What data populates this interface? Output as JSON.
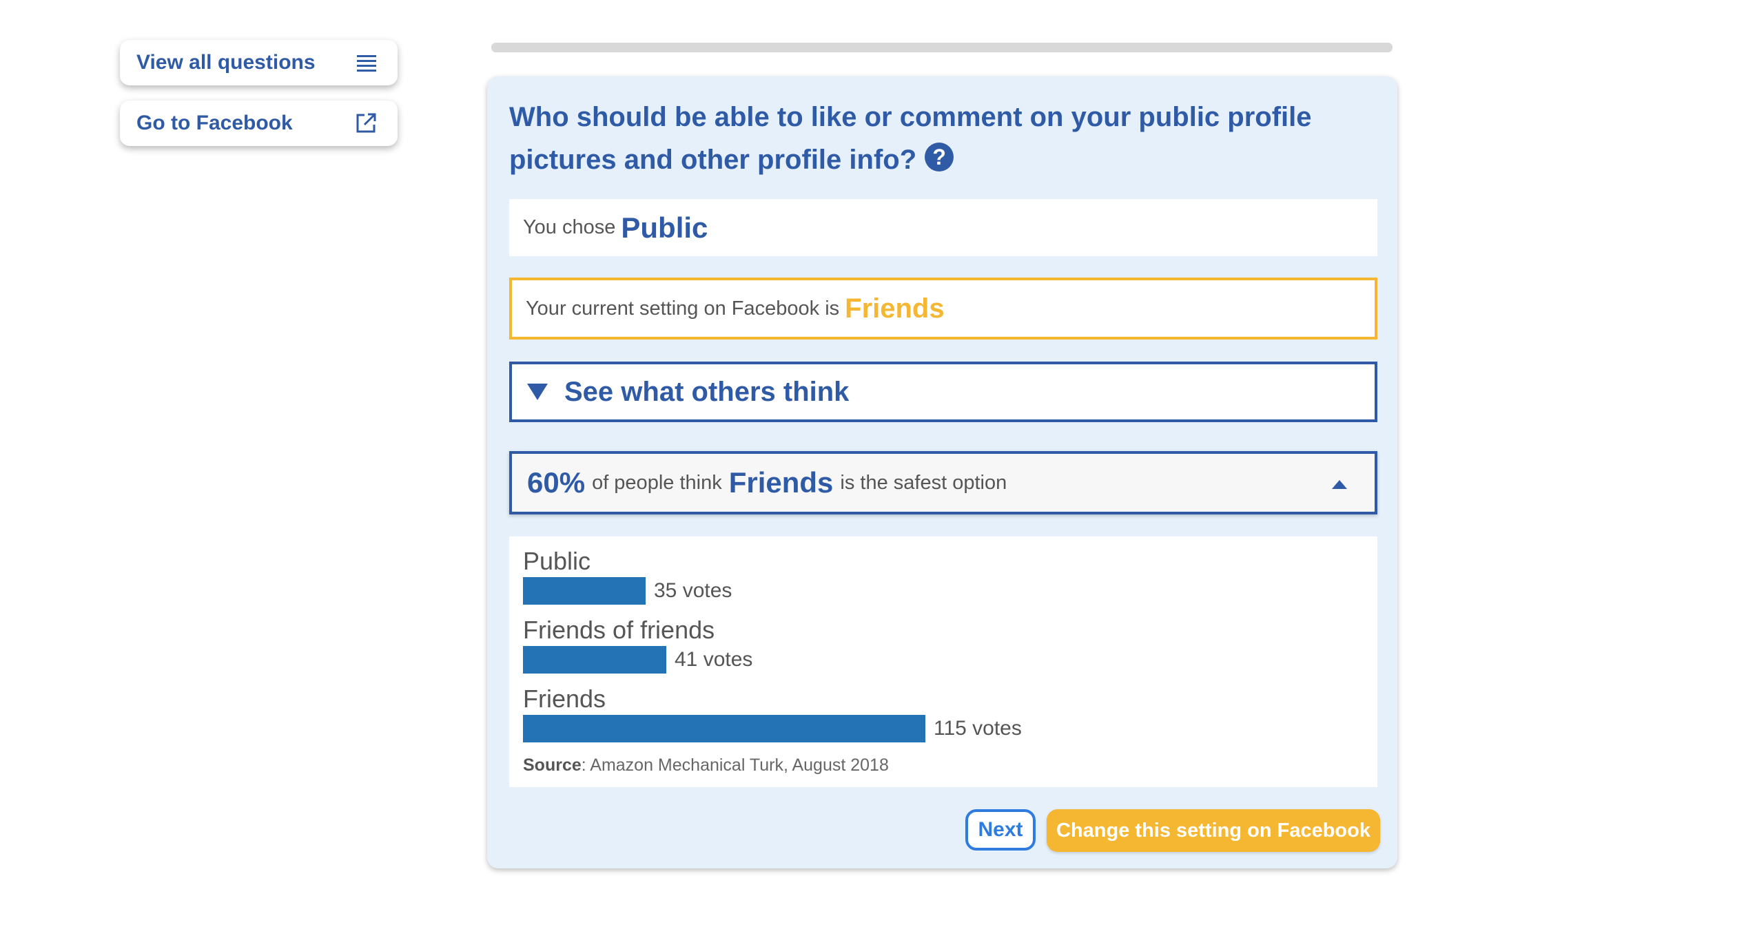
{
  "sidebar": {
    "view_all_label": "View all questions",
    "view_all_icon": "list-icon",
    "go_facebook_label": "Go to Facebook",
    "go_facebook_icon": "external-link-icon"
  },
  "progress": {
    "fraction": 1.0
  },
  "question": {
    "text": "Who should be able to like or comment on your public profile pictures and other profile info?",
    "help_icon": "question-mark-icon",
    "help_glyph": "?"
  },
  "choice": {
    "prefix": "You chose",
    "value": "Public"
  },
  "current": {
    "prefix": "Your current setting on Facebook is",
    "value": "Friends"
  },
  "others": {
    "label": "See what others think"
  },
  "summary": {
    "percent": "60%",
    "text_before": "of people think",
    "option": "Friends",
    "text_after": "is the safest option"
  },
  "chart_data": {
    "type": "bar",
    "orientation": "horizontal",
    "categories": [
      "Public",
      "Friends of friends",
      "Friends"
    ],
    "values": [
      35,
      41,
      115
    ],
    "value_labels": [
      "35 votes",
      "41 votes",
      "115 votes"
    ],
    "source_label": "Source",
    "source_text": ": Amazon Mechanical Turk, August 2018",
    "bar_color": "#2473b4"
  },
  "actions": {
    "next_label": "Next",
    "change_label": "Change this setting on Facebook"
  },
  "colors": {
    "brand_blue": "#2f5aa6",
    "accent_orange": "#f5b731",
    "card_bg": "#e5f0fb"
  }
}
